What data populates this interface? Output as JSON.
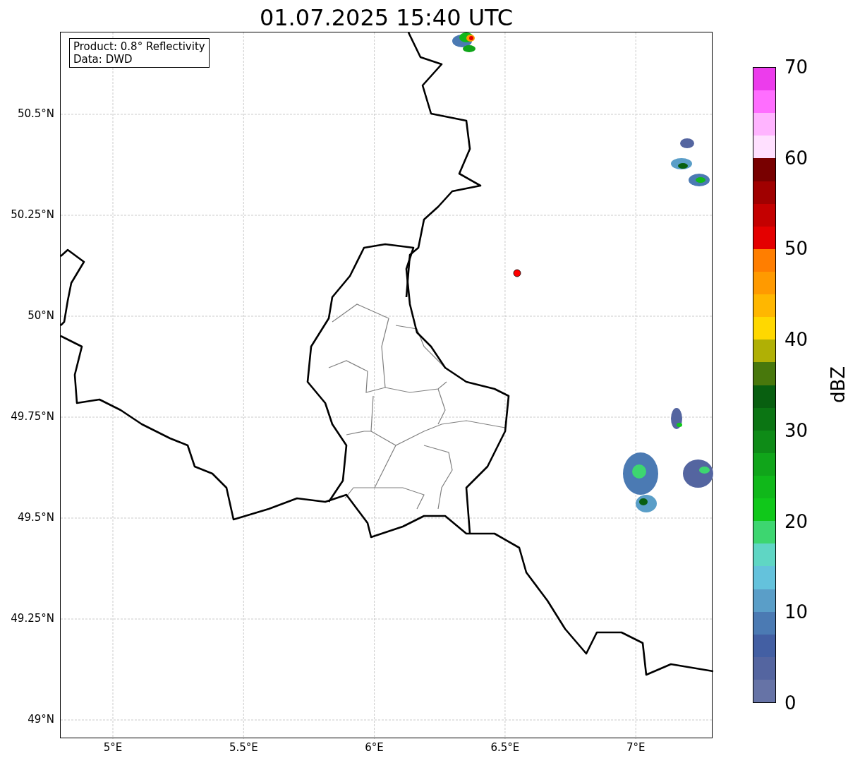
{
  "title": "01.07.2025 15:40 UTC",
  "map": {
    "info_lines": [
      "Product: 0.8° Reflectivity",
      "Data: DWD"
    ],
    "lat_ticks": [
      "50.5°N",
      "50.25°N",
      "50°N",
      "49.75°N",
      "49.5°N",
      "49.25°N",
      "49°N"
    ],
    "lon_ticks": [
      "5°E",
      "5.5°E",
      "6°E",
      "6.5°E",
      "7°E"
    ]
  },
  "colorbar": {
    "label": "dBZ",
    "ticks": [
      "70",
      "60",
      "50",
      "40",
      "30",
      "20",
      "10",
      "0"
    ],
    "bins": [
      {
        "color": "#ec3cec"
      },
      {
        "color": "#ff6eff"
      },
      {
        "color": "#ffb4ff"
      },
      {
        "color": "#ffe0ff"
      },
      {
        "color": "#780000"
      },
      {
        "color": "#a00000"
      },
      {
        "color": "#c40000"
      },
      {
        "color": "#e40000"
      },
      {
        "color": "#ff7e00"
      },
      {
        "color": "#ff9a00"
      },
      {
        "color": "#ffb700"
      },
      {
        "color": "#ffd800"
      },
      {
        "color": "#b0b005"
      },
      {
        "color": "#48780c"
      },
      {
        "color": "#085f10"
      },
      {
        "color": "#0b7513"
      },
      {
        "color": "#0e8b17"
      },
      {
        "color": "#10a51a"
      },
      {
        "color": "#10b81a"
      },
      {
        "color": "#10c81a"
      },
      {
        "color": "#3dd670"
      },
      {
        "color": "#5fd6c4"
      },
      {
        "color": "#64c2dc"
      },
      {
        "color": "#5a9ec8"
      },
      {
        "color": "#4b7ab3"
      },
      {
        "color": "#435fa3"
      },
      {
        "color": "#5465a0"
      },
      {
        "color": "#6673a6"
      }
    ]
  }
}
